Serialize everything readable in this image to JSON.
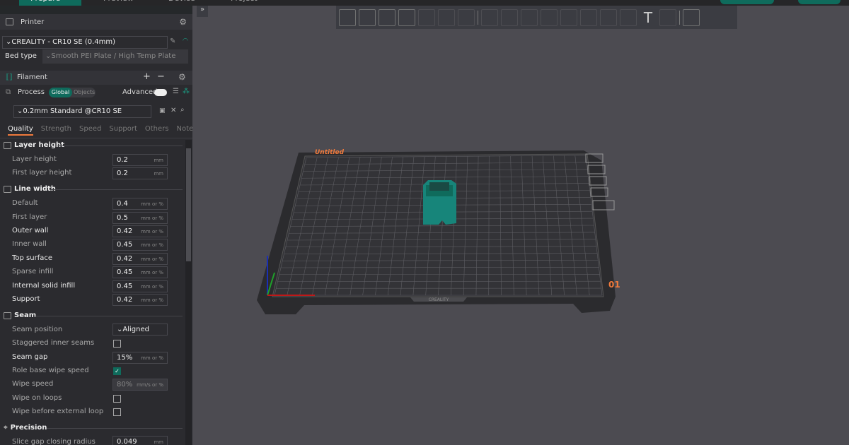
{
  "topbar": {
    "tabs": [
      "Prepare",
      "Preview",
      "Device",
      "Project"
    ]
  },
  "printer": {
    "title": "Printer",
    "name": "CREALITY - CR10 SE (0.4mm)",
    "bed_type_label": "Bed type",
    "bed_type": "Smooth PEI Plate / High Temp Plate"
  },
  "filament": {
    "title": "Filament",
    "add": "+",
    "remove": "−"
  },
  "process": {
    "title": "Process",
    "global": "Global",
    "objects": "Objects",
    "advanced": "Advanced",
    "advanced_on": false,
    "preset": "0.2mm Standard @CR10 SE"
  },
  "tabs": [
    {
      "label": "Quality",
      "active": true
    },
    {
      "label": "Strength"
    },
    {
      "label": "Speed"
    },
    {
      "label": "Support"
    },
    {
      "label": "Others"
    },
    {
      "label": "Notes"
    }
  ],
  "groups": {
    "layer_height": "Layer height",
    "line_width": "Line width",
    "seam": "Seam",
    "precision": "Precision"
  },
  "settings": {
    "layer_height": {
      "label": "Layer height",
      "value": "0.2",
      "unit": "mm"
    },
    "first_layer_height": {
      "label": "First layer height",
      "value": "0.2",
      "unit": "mm"
    },
    "default": {
      "label": "Default",
      "value": "0.4",
      "unit": "mm or %"
    },
    "first_layer": {
      "label": "First layer",
      "value": "0.5",
      "unit": "mm or %"
    },
    "outer_wall": {
      "label": "Outer wall",
      "value": "0.42",
      "unit": "mm or %"
    },
    "inner_wall": {
      "label": "Inner wall",
      "value": "0.45",
      "unit": "mm or %"
    },
    "top_surface": {
      "label": "Top surface",
      "value": "0.42",
      "unit": "mm or %"
    },
    "sparse_infill": {
      "label": "Sparse infill",
      "value": "0.45",
      "unit": "mm or %"
    },
    "internal_solid_infill": {
      "label": "Internal solid infill",
      "value": "0.45",
      "unit": "mm or %"
    },
    "support": {
      "label": "Support",
      "value": "0.42",
      "unit": "mm or %"
    },
    "seam_position": {
      "label": "Seam position",
      "value": "Aligned"
    },
    "staggered": {
      "label": "Staggered inner seams",
      "checked": false
    },
    "seam_gap": {
      "label": "Seam gap",
      "value": "15%",
      "unit": "mm or %"
    },
    "role_wipe": {
      "label": "Role base wipe speed",
      "checked": true
    },
    "wipe_speed": {
      "label": "Wipe speed",
      "value": "80%",
      "unit": "mm/s or %"
    },
    "wipe_loops": {
      "label": "Wipe on loops",
      "checked": false
    },
    "wipe_before": {
      "label": "Wipe before external loop",
      "checked": false
    },
    "slice_gap": {
      "label": "Slice gap closing radius",
      "value": "0.049",
      "unit": "mm"
    }
  },
  "plate": {
    "name": "Untitled",
    "number": "01",
    "brand": "CREALITY",
    "accent": "#f07a3c",
    "model_color": "#17857a"
  }
}
